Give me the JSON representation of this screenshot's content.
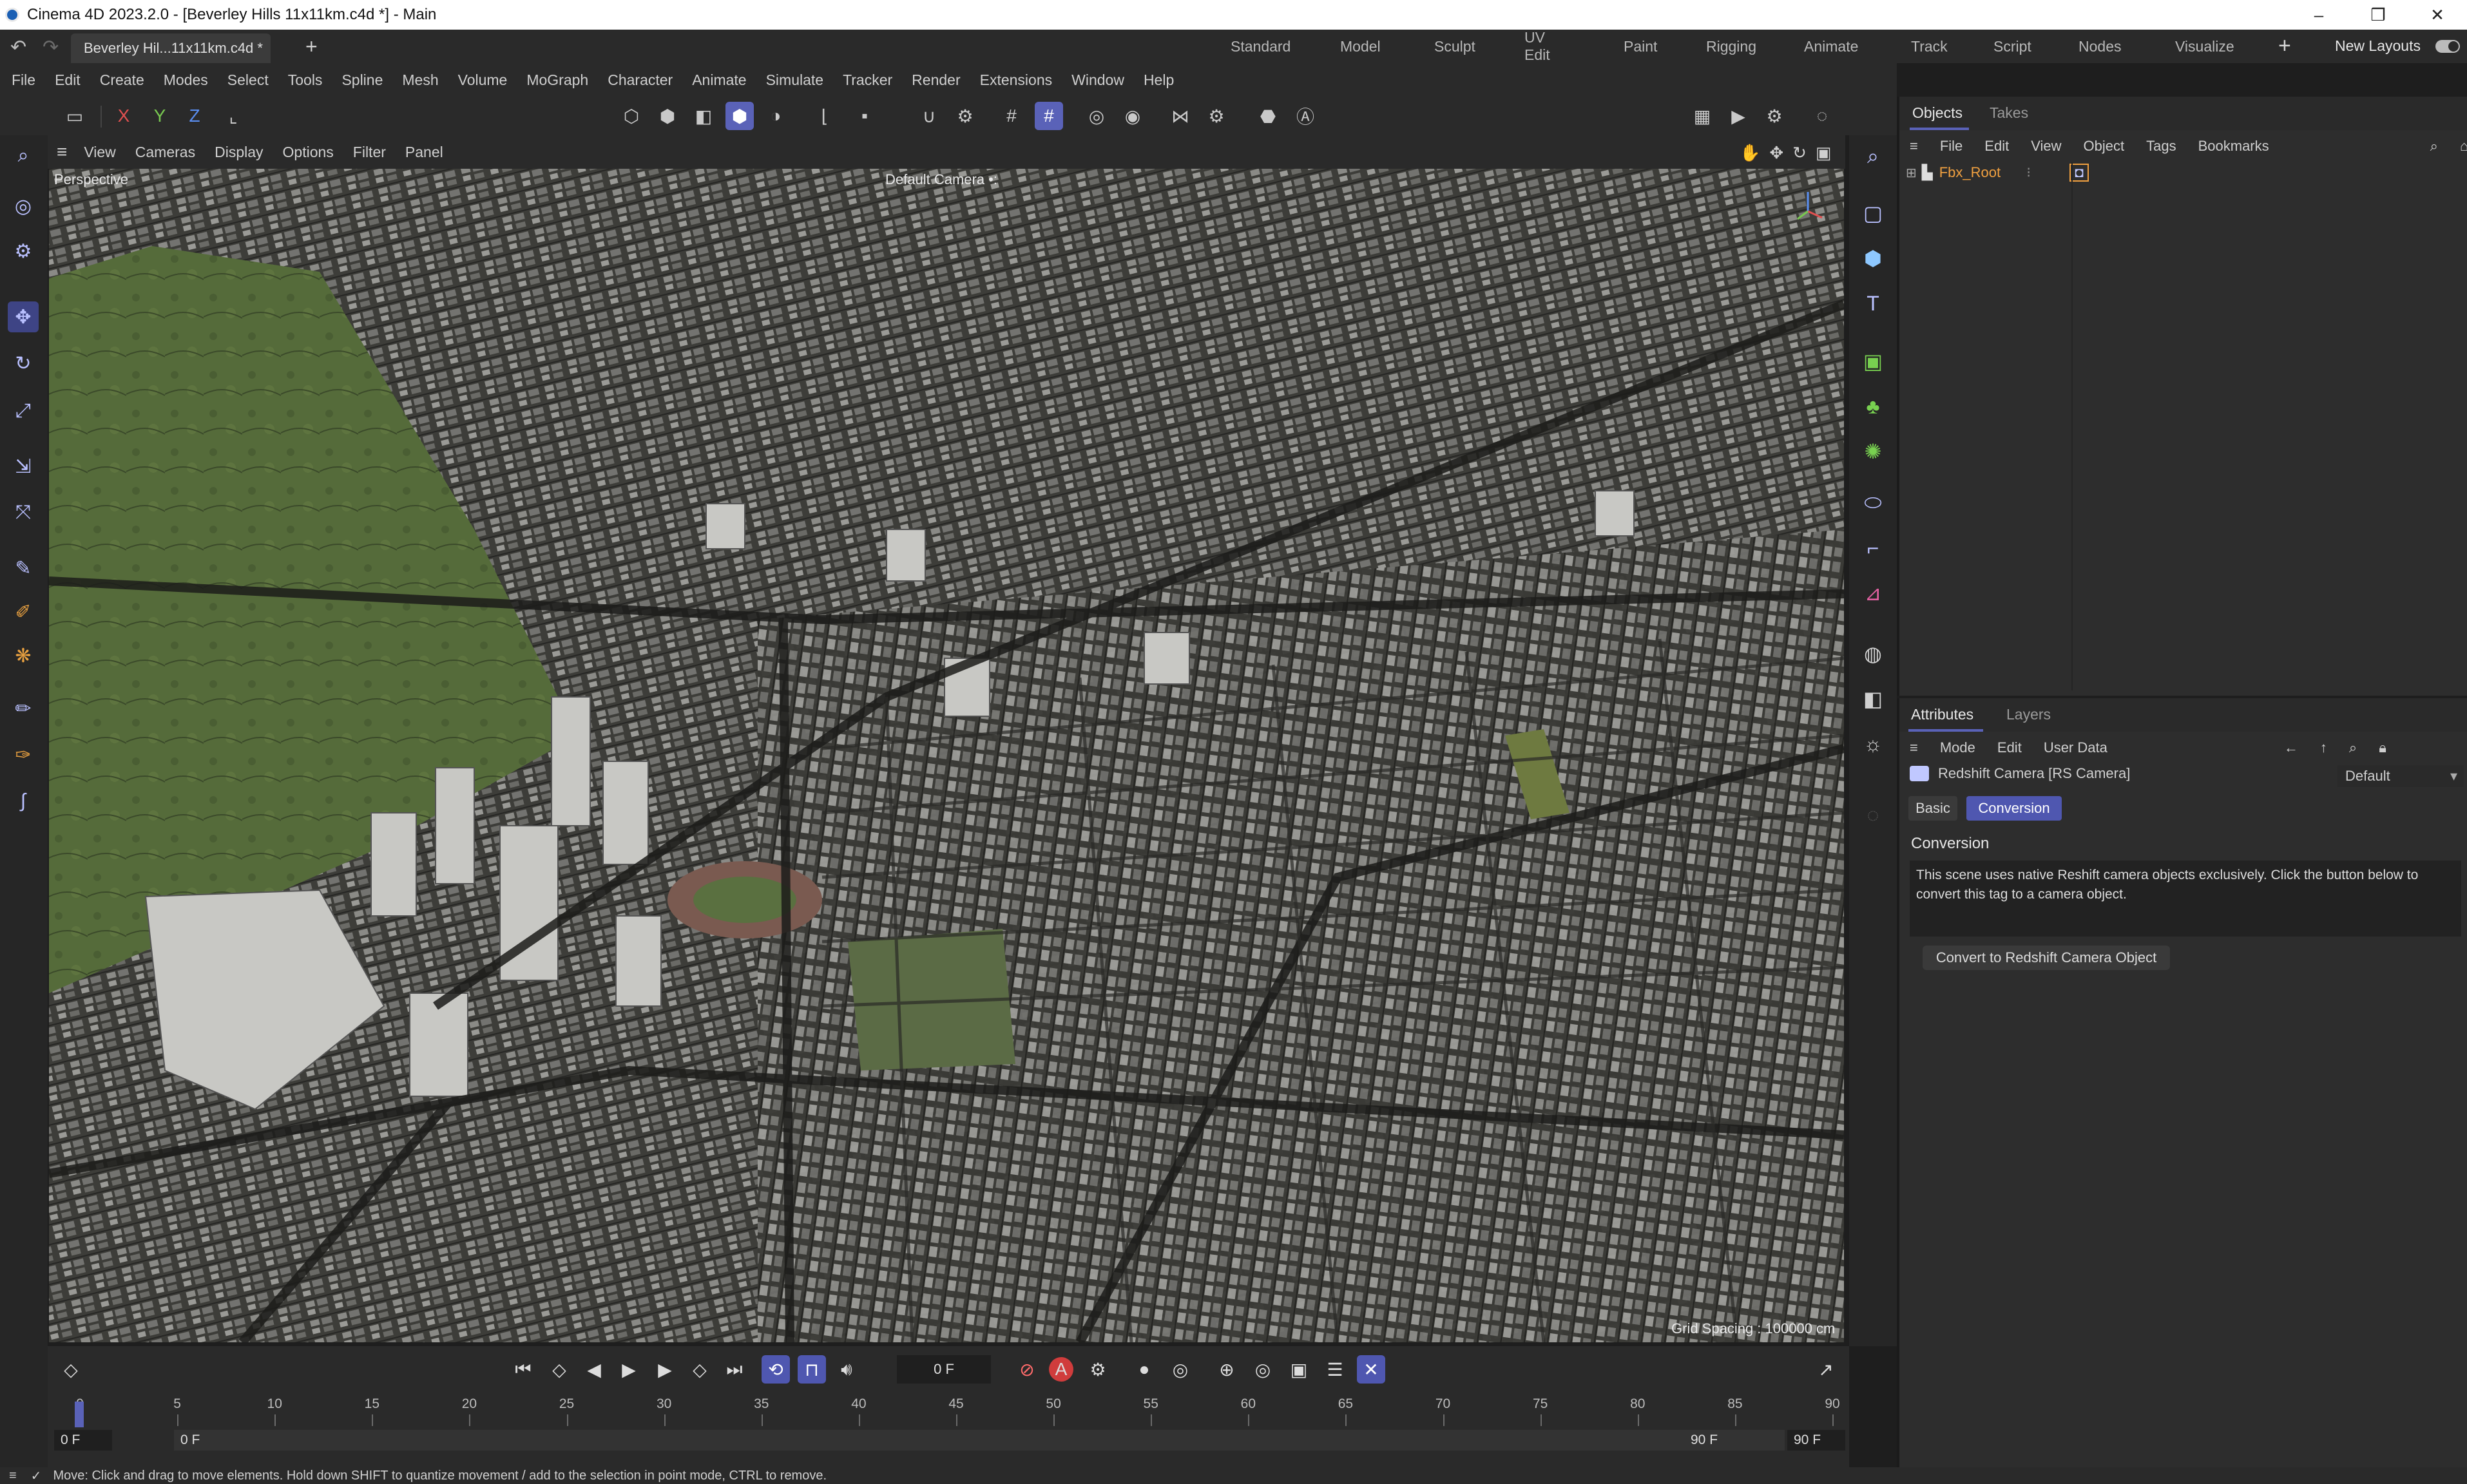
{
  "window": {
    "title": "Cinema 4D 2023.2.0 - [Beverley Hills 11x11km.c4d *] - Main",
    "minimize": "–",
    "restore": "❒",
    "close": "✕"
  },
  "doc_tab": {
    "label": "Beverley Hil...11x11km.c4d *",
    "add": "+"
  },
  "layouts": [
    "Standard",
    "Model",
    "Sculpt",
    "UV Edit",
    "Paint",
    "Rigging",
    "Animate",
    "Track",
    "Script",
    "Nodes",
    "Visualize"
  ],
  "layouts_add": "+",
  "new_layouts": "New Layouts",
  "menu": [
    "File",
    "Edit",
    "Create",
    "Modes",
    "Select",
    "Tools",
    "Spline",
    "Mesh",
    "Volume",
    "MoGraph",
    "Character",
    "Animate",
    "Simulate",
    "Tracker",
    "Render",
    "Extensions",
    "Window",
    "Help"
  ],
  "toolbar": {
    "x_label": "X",
    "y_label": "Y",
    "z_label": "Z"
  },
  "viewport": {
    "menu": [
      "View",
      "Cameras",
      "Display",
      "Options",
      "Filter",
      "Panel"
    ],
    "label": "Perspective",
    "camera": "Default Camera •:",
    "grid_spacing": "Grid Spacing : 100000 cm"
  },
  "objects_panel": {
    "tabs": [
      "Objects",
      "Takes"
    ],
    "menu": [
      "File",
      "Edit",
      "View",
      "Object",
      "Tags",
      "Bookmarks"
    ],
    "root_object": "Fbx_Root"
  },
  "attributes_panel": {
    "tabs": [
      "Attributes",
      "Layers"
    ],
    "menu": [
      "Mode",
      "Edit",
      "User Data"
    ],
    "object_title": "Redshift Camera [RS Camera]",
    "preset": "Default",
    "subtabs": [
      "Basic",
      "Conversion"
    ],
    "section_title": "Conversion",
    "description": "This scene uses native Reshift camera objects exclusively. Click the button below to convert this tag to a camera object.",
    "convert_button": "Convert to Redshift Camera Object"
  },
  "timeline": {
    "current_frame": "0 F",
    "ticks": [
      "0",
      "5",
      "10",
      "15",
      "20",
      "25",
      "30",
      "35",
      "40",
      "45",
      "50",
      "55",
      "60",
      "65",
      "70",
      "75",
      "80",
      "85",
      "90"
    ],
    "start_frame": "0 F",
    "range_start": "0 F",
    "range_end": "90 F",
    "end_frame": "90 F",
    "record_label": "A"
  },
  "status": {
    "message": "Move: Click and drag to move elements. Hold down SHIFT to quantize movement / add to the selection in point mode, CTRL to remove."
  },
  "colors": {
    "accent": "#5a62b8",
    "object_name": "#f0a040",
    "record": "#d03c3c"
  }
}
